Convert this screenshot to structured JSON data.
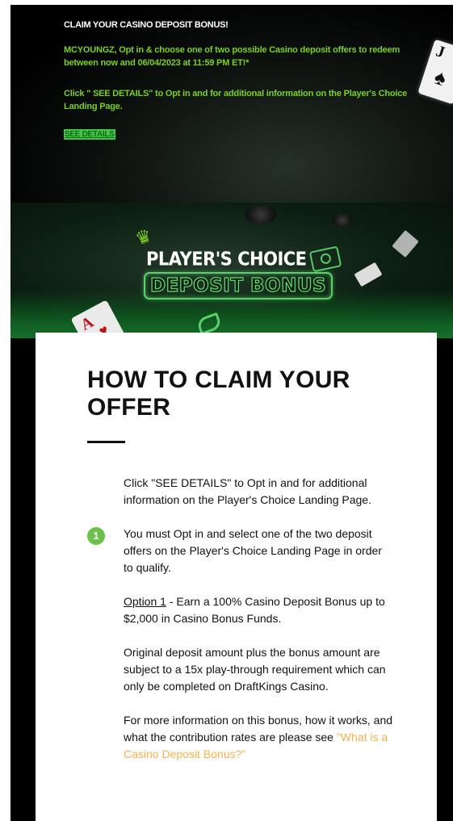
{
  "header": {
    "title": "CLAIM YOUR CASINO DEPOSIT BONUS!",
    "paragraph1": "MCYOUNGZ, Opt in & choose one of two possible Casino deposit offers to redeem between now and 06/04/2023 at 11:59 PM ET!*",
    "paragraph2": "Click \" SEE DETAILS\" to Opt in and for additional information on the Player's Choice Landing Page.",
    "cta_label": "SEE DETAILS"
  },
  "banner": {
    "title": "PLAYER'S CHOICE",
    "subtitle": "DEPOSIT BONUS",
    "card_j": "J",
    "card_a": "A"
  },
  "content": {
    "heading": "HOW TO CLAIM YOUR OFFER",
    "step_number": "1",
    "p1": "Click \"SEE DETAILS\" to Opt in and for additional information on the Player's Choice Landing Page.",
    "p2": "You must Opt in and select one of the two deposit offers on the Player's Choice Landing Page in order to qualify.",
    "option_label": "Option 1",
    "option_text": " - Earn a 100% Casino Deposit Bonus up to $2,000 in Casino Bonus Funds.",
    "p4": "Original deposit amount plus the bonus amount are subject to a 15x play-through requirement which can only be completed on DraftKings Casino.",
    "p5_text": "For more information on this bonus, how it works, and what the contribution rates are please see ",
    "p5_link": "\"What is a Casino Deposit Bonus?\""
  },
  "colors": {
    "accent_green": "#7ad11f",
    "button_green": "#45c44a",
    "step_green": "#6ac24a",
    "link_orange": "#f4b24a"
  }
}
